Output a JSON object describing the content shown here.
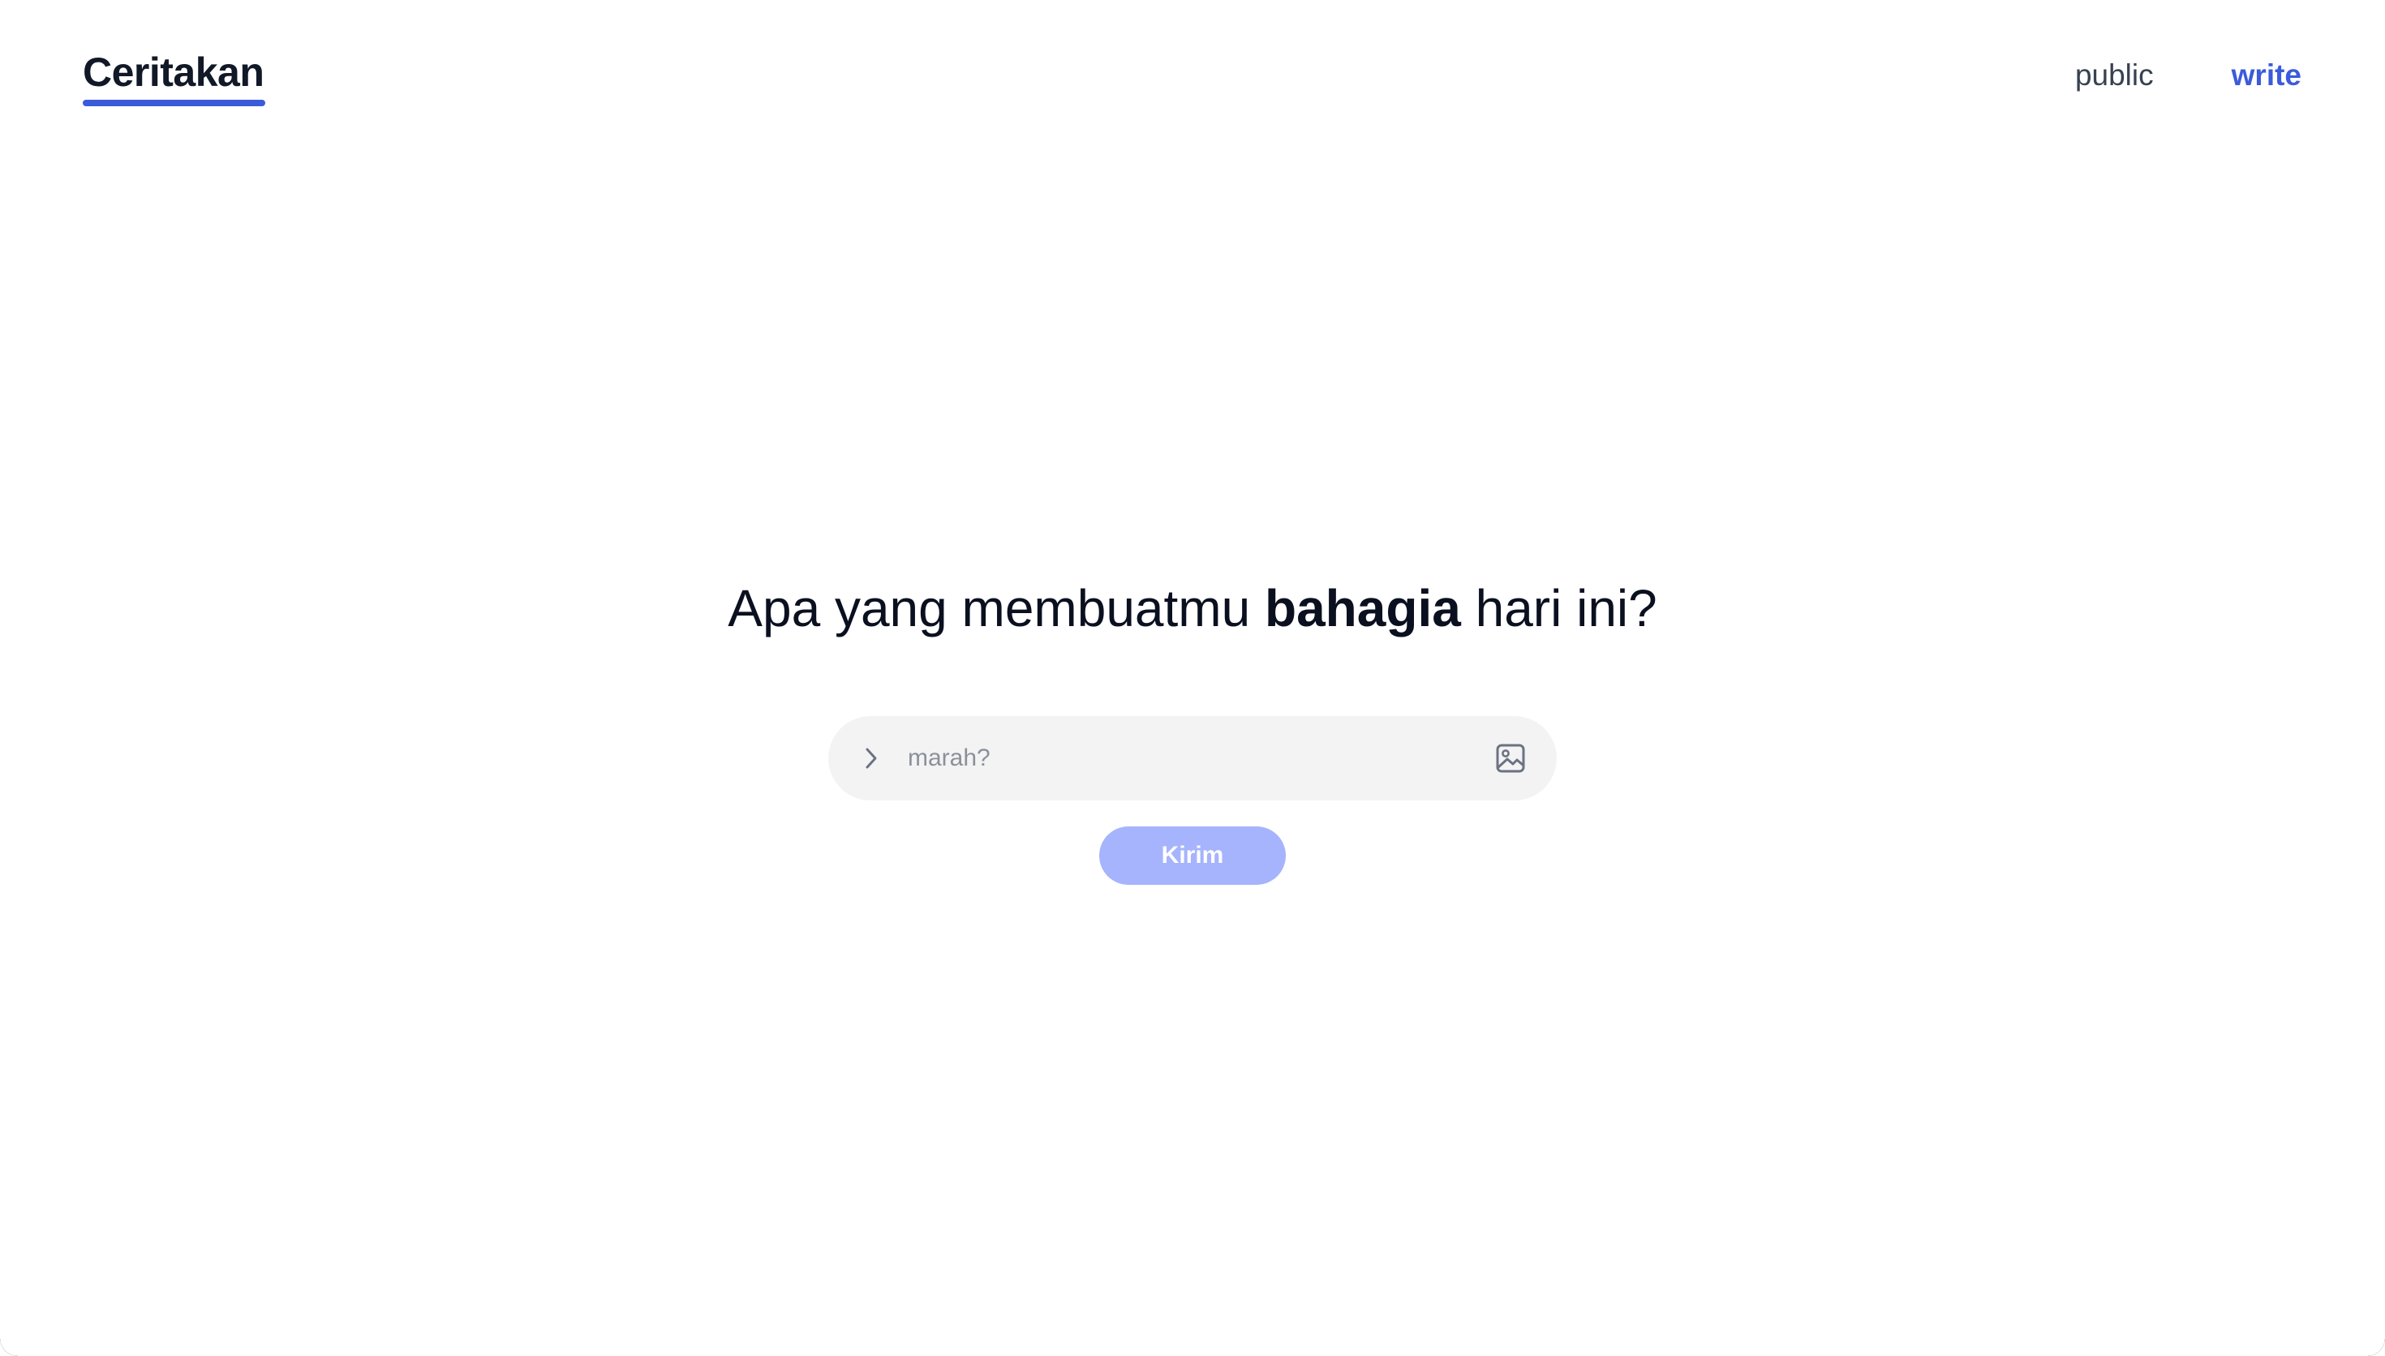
{
  "header": {
    "brand": "Ceritakan",
    "nav": {
      "public_label": "public",
      "write_label": "write"
    }
  },
  "main": {
    "headline_before": "Apa yang membuatmu ",
    "headline_bold": "bahagia",
    "headline_after": " hari ini?",
    "input": {
      "placeholder": "marah?",
      "value": ""
    },
    "submit_label": "Kirim"
  },
  "colors": {
    "accent": "#3b5bdb",
    "submit_disabled": "#a5b4fc",
    "input_bg": "#f3f3f4",
    "heading": "#0b1020"
  },
  "icons": {
    "prompt": "chevron-right-icon",
    "attach": "image-icon"
  }
}
